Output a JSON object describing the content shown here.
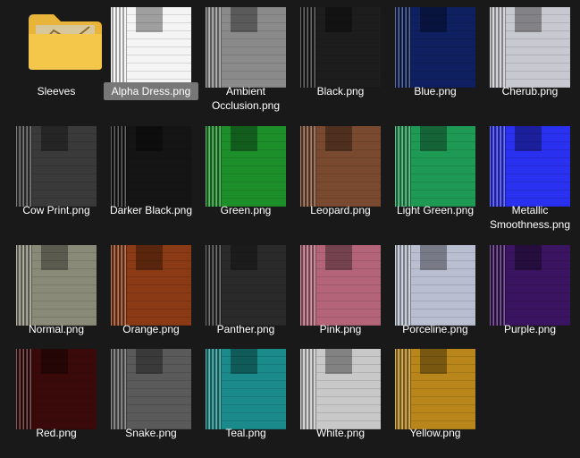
{
  "items": [
    {
      "label": "Sleeves",
      "type": "folder"
    },
    {
      "label": "Alpha Dress.png",
      "type": "image",
      "color": "#f4f4f4",
      "selected": true
    },
    {
      "label": "Ambient Occlusion.png",
      "type": "image",
      "color": "#8a8a8a"
    },
    {
      "label": "Black.png",
      "type": "image",
      "color": "#1d1d1d"
    },
    {
      "label": "Blue.png",
      "type": "image",
      "color": "#0f2060"
    },
    {
      "label": "Cherub.png",
      "type": "image",
      "color": "#c8c8d0"
    },
    {
      "label": "Cow Print.png",
      "type": "image",
      "color": "#3a3a3a"
    },
    {
      "label": "Darker Black.png",
      "type": "image",
      "color": "#141414"
    },
    {
      "label": "Green.png",
      "type": "image",
      "color": "#1d8f2a"
    },
    {
      "label": "Leopard.png",
      "type": "image",
      "color": "#7a4a30"
    },
    {
      "label": "Light Green.png",
      "type": "image",
      "color": "#1f9a55"
    },
    {
      "label": "Metallic Smoothness.png",
      "type": "image",
      "color": "#2a30f0"
    },
    {
      "label": "Normal.png",
      "type": "image",
      "color": "#8a8a78"
    },
    {
      "label": "Orange.png",
      "type": "image",
      "color": "#8a3a14"
    },
    {
      "label": "Panther.png",
      "type": "image",
      "color": "#2a2a2a"
    },
    {
      "label": "Pink.png",
      "type": "image",
      "color": "#b36478"
    },
    {
      "label": "Porceline.png",
      "type": "image",
      "color": "#b9bed0"
    },
    {
      "label": "Purple.png",
      "type": "image",
      "color": "#3a1460"
    },
    {
      "label": "Red.png",
      "type": "image",
      "color": "#3a0a0a"
    },
    {
      "label": "Snake.png",
      "type": "image",
      "color": "#5a5a5a"
    },
    {
      "label": "Teal.png",
      "type": "image",
      "color": "#1a8a8a"
    },
    {
      "label": "White.png",
      "type": "image",
      "color": "#c8c8c8"
    },
    {
      "label": "Yellow.png",
      "type": "image",
      "color": "#b8861a"
    }
  ],
  "icons": {
    "folder": "folder-icon",
    "thumbnail": "image-thumbnail-icon"
  }
}
